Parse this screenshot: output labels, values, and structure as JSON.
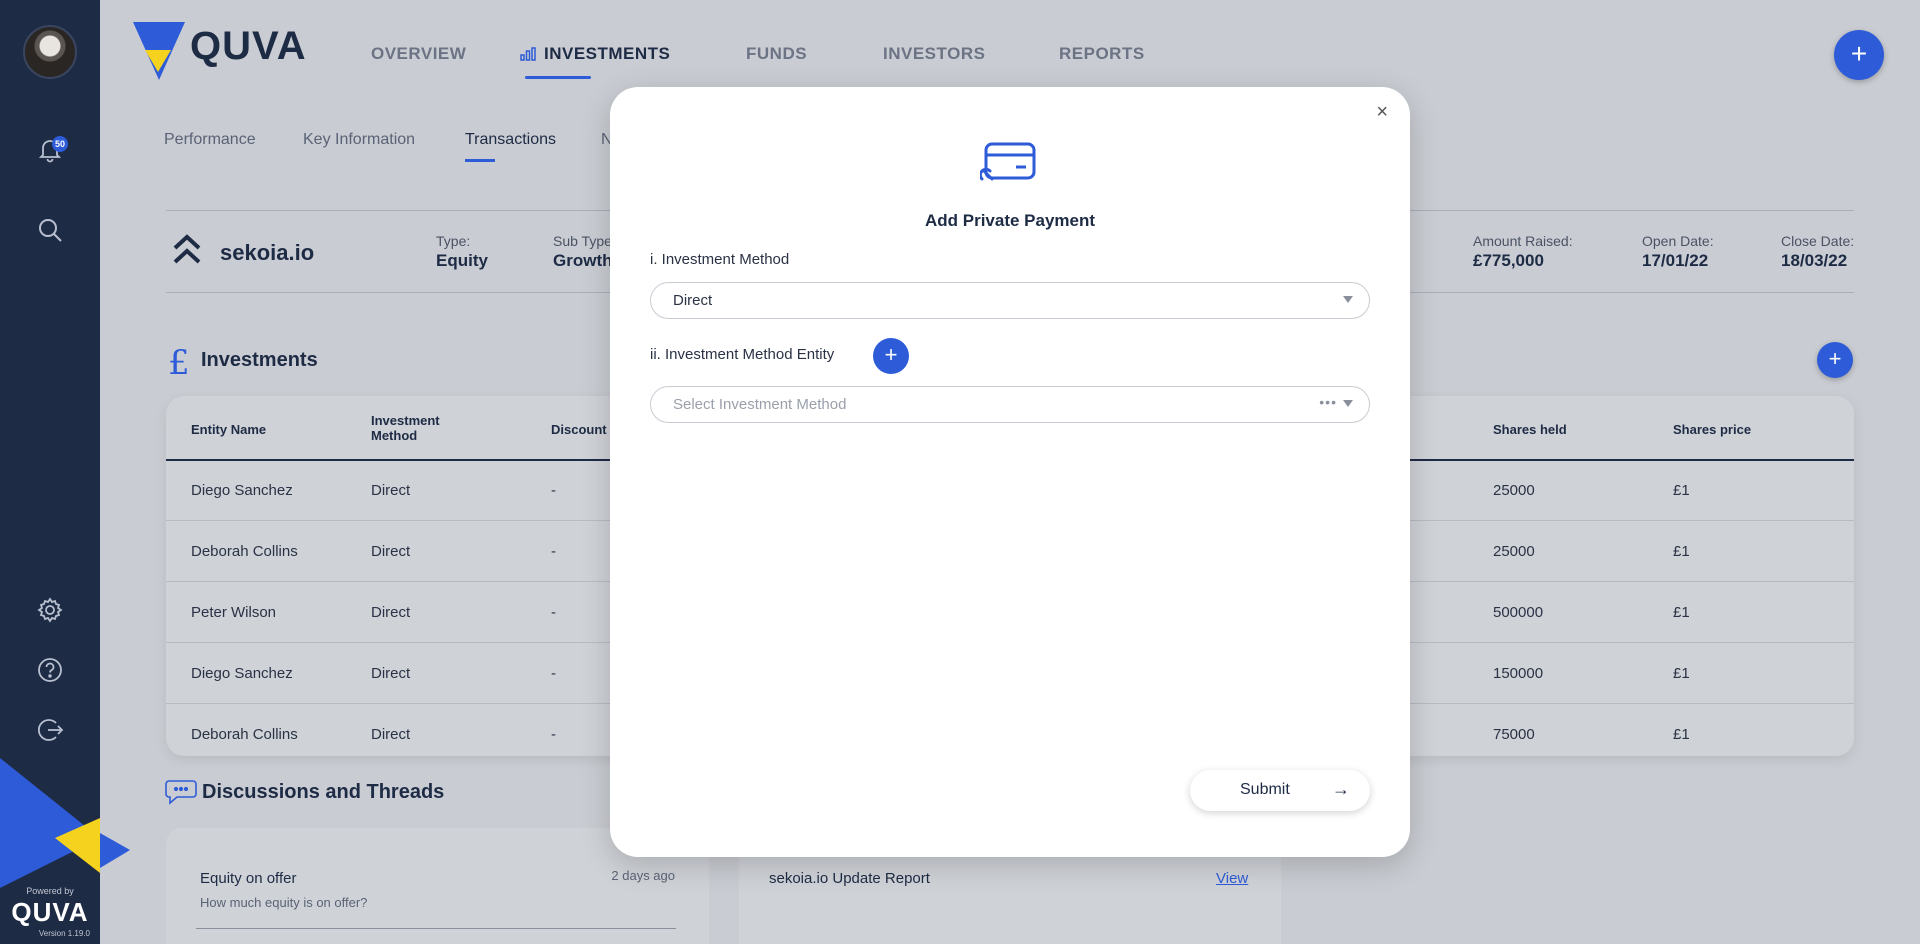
{
  "sidebar": {
    "notification_count": "50",
    "powered_by": "Powered by",
    "brand": "QUVA",
    "version": "Version 1.19.0"
  },
  "header": {
    "logo_text": "QUVA",
    "nav": [
      "OVERVIEW",
      "INVESTMENTS",
      "FUNDS",
      "INVESTORS",
      "REPORTS"
    ],
    "active_nav": "INVESTMENTS"
  },
  "subtabs": [
    "Performance",
    "Key Information",
    "Transactions",
    "N"
  ],
  "company": {
    "name": "sekoia.io",
    "type_label": "Type:",
    "type_value": "Equity",
    "subtype_label": "Sub Type",
    "subtype_value": "Growth",
    "amount_label": "Amount Raised:",
    "amount_value": "£775,000",
    "open_label": "Open Date:",
    "open_value": "17/01/22",
    "close_label": "Close Date:",
    "close_value": "18/03/22"
  },
  "investments": {
    "title": "Investments",
    "columns": {
      "entity": "Entity Name",
      "method": "Investment Method",
      "discount": "Discount",
      "shares_held": "Shares held",
      "shares_price": "Shares price"
    },
    "rows": [
      {
        "entity": "Diego Sanchez",
        "method": "Direct",
        "discount": "-",
        "shares_held": "25000",
        "shares_price": "£1"
      },
      {
        "entity": "Deborah Collins",
        "method": "Direct",
        "discount": "-",
        "shares_held": "25000",
        "shares_price": "£1"
      },
      {
        "entity": "Peter Wilson",
        "method": "Direct",
        "discount": "-",
        "shares_held": "500000",
        "shares_price": "£1"
      },
      {
        "entity": "Diego Sanchez",
        "method": "Direct",
        "discount": "-",
        "shares_held": "150000",
        "shares_price": "£1"
      },
      {
        "entity": "Deborah Collins",
        "method": "Direct",
        "discount": "-",
        "shares_held": "75000",
        "shares_price": "£1"
      }
    ]
  },
  "discussions": {
    "title": "Discussions and Threads",
    "thread_title": "Equity on offer",
    "thread_sub": "How much equity is on offer?",
    "thread_time": "2 days ago",
    "report_title": "sekoia.io Update Report",
    "report_link": "View"
  },
  "modal": {
    "title": "Add Private Payment",
    "field1_label": "i. Investment Method",
    "field1_value": "Direct",
    "field2_label": "ii. Investment Method Entity",
    "field2_placeholder": "Select Investment Method",
    "submit_label": "Submit",
    "close_symbol": "×",
    "add_symbol": "+"
  },
  "colors": {
    "accent": "#2e5bd8",
    "sidebar": "#1e2b45",
    "brand_yellow": "#f5d21e"
  }
}
